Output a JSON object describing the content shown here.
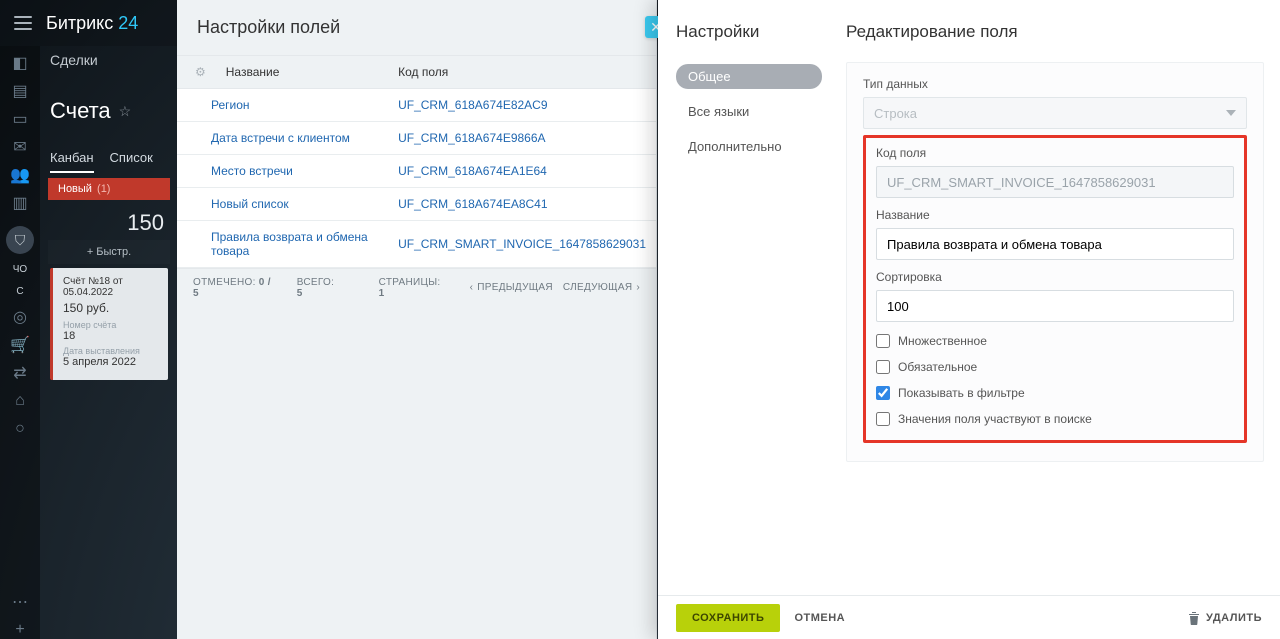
{
  "brand": {
    "a": "Битрикс",
    "b": "24"
  },
  "bg": {
    "nav": "Сделки",
    "title": "Счета",
    "tabs": {
      "kanban": "Канбан",
      "list": "Список"
    },
    "stage": {
      "name": "Новый",
      "count": "(1)"
    },
    "sum": "150",
    "quick": "+ Быстр.",
    "card": {
      "title": "Счёт №18 от 05.04.2022",
      "price": "150 руб.",
      "num_lbl": "Номер счёта",
      "num_val": "18",
      "date_lbl": "Дата выставления",
      "date_val": "5 апреля 2022"
    }
  },
  "rail_letters": {
    "a": "ЧО",
    "b": "С"
  },
  "panel1": {
    "title": "Настройки полей",
    "cols": {
      "name": "Название",
      "code": "Код поля"
    },
    "rows": [
      {
        "name": "Регион",
        "code": "UF_CRM_618A674E82AC9"
      },
      {
        "name": "Дата встречи с клиентом",
        "code": "UF_CRM_618A674E9866A"
      },
      {
        "name": "Место встречи",
        "code": "UF_CRM_618A674EA1E64"
      },
      {
        "name": "Новый список",
        "code": "UF_CRM_618A674EA8C41"
      },
      {
        "name": "Правила возврата и обмена товара",
        "code": "UF_CRM_SMART_INVOICE_1647858629031"
      }
    ],
    "footer": {
      "selected_lbl": "ОТМЕЧЕНО:",
      "selected_val": "0 / 5",
      "total_lbl": "ВСЕГО:",
      "total_val": "5",
      "pages_lbl": "СТРАНИЦЫ:",
      "pages_val": "1",
      "prev": "ПРЕДЫДУЩАЯ",
      "next": "СЛЕДУЮЩАЯ"
    }
  },
  "panel2": {
    "nav_title": "Настройки",
    "nav": {
      "general": "Общее",
      "languages": "Все языки",
      "additional": "Дополнительно"
    },
    "form_title": "Редактирование поля",
    "labels": {
      "type": "Тип данных",
      "code": "Код поля",
      "name": "Название",
      "sort": "Сортировка"
    },
    "values": {
      "type": "Строка",
      "code": "UF_CRM_SMART_INVOICE_1647858629031",
      "name": "Правила возврата и обмена товара",
      "sort": "100"
    },
    "checks": {
      "multiple": "Множественное",
      "required": "Обязательное",
      "show_filter": "Показывать в фильтре",
      "in_search": "Значения поля участвуют в поиске"
    },
    "footer": {
      "save": "СОХРАНИТЬ",
      "cancel": "ОТМЕНА",
      "delete": "УДАЛИТЬ"
    }
  }
}
